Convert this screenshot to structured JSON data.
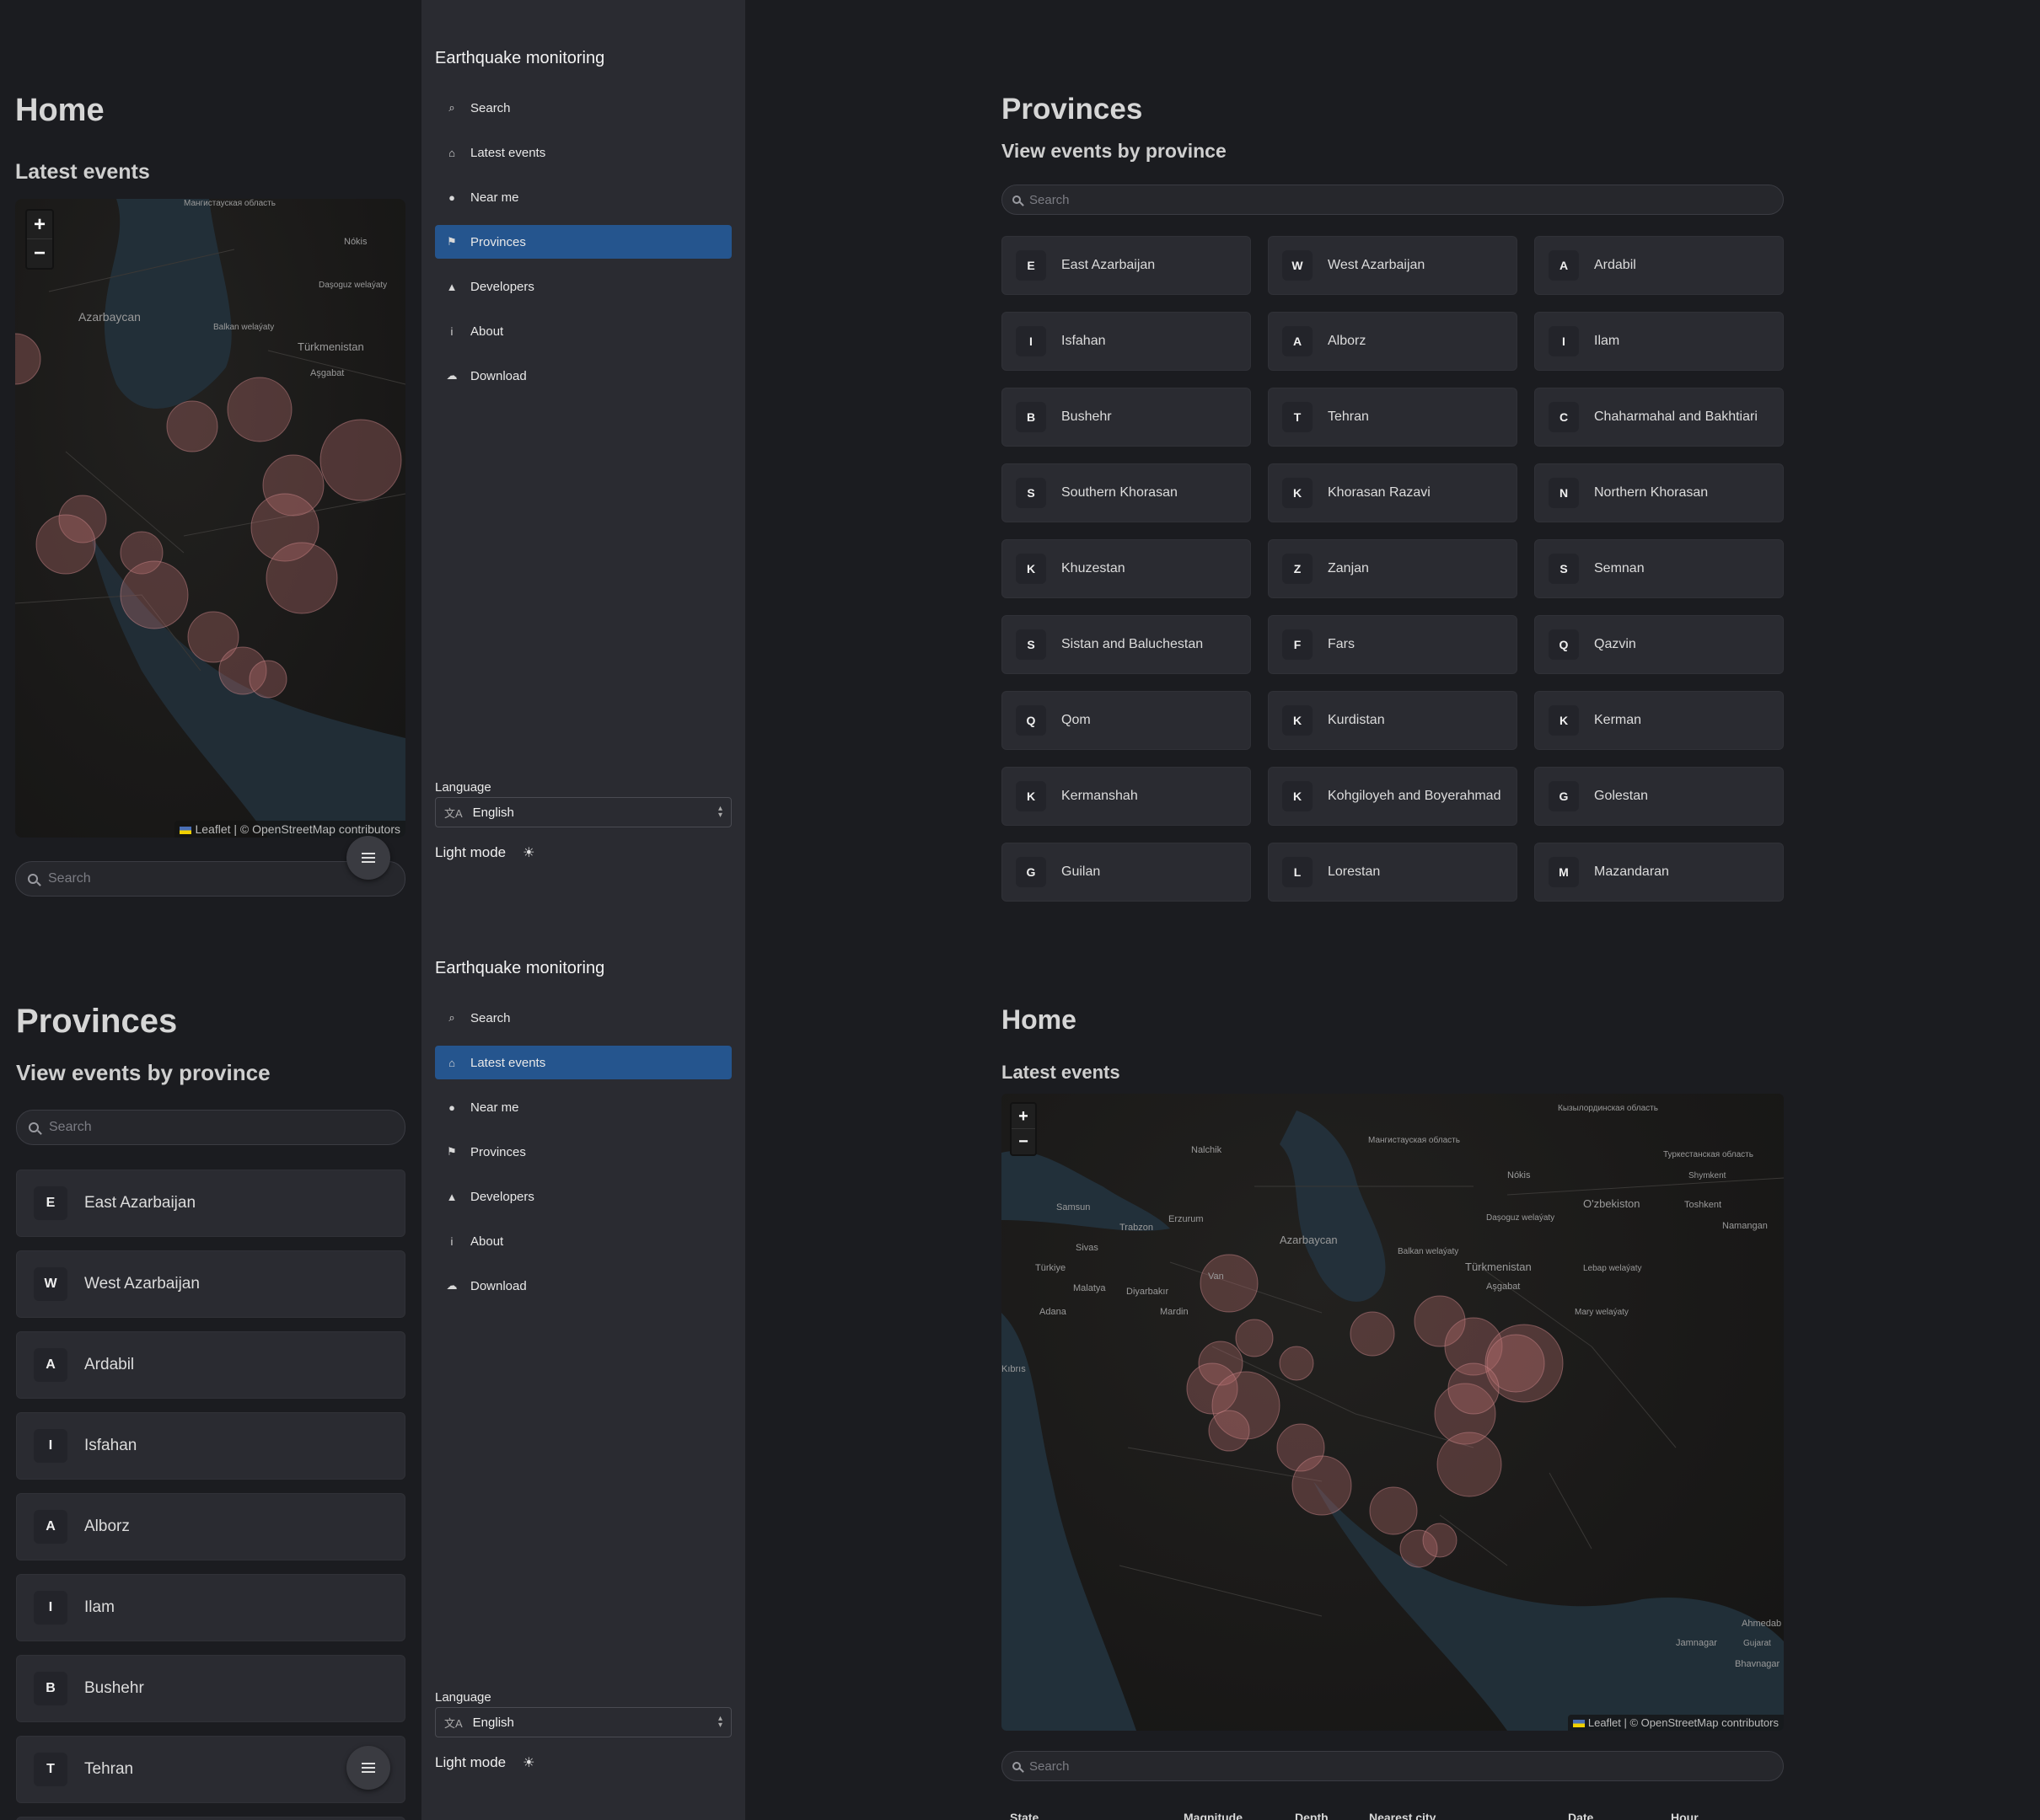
{
  "nav": {
    "title": "Earthquake monitoring",
    "items": [
      {
        "label": "Search",
        "icon": "search-icon"
      },
      {
        "label": "Latest events",
        "icon": "home-icon"
      },
      {
        "label": "Near me",
        "icon": "location-pin-icon"
      },
      {
        "label": "Provinces",
        "icon": "flag-icon"
      },
      {
        "label": "Developers",
        "icon": "shapes-icon"
      },
      {
        "label": "About",
        "icon": "info-icon"
      },
      {
        "label": "Download",
        "icon": "cloud-download-icon"
      }
    ],
    "language_label": "Language",
    "language_value": "English",
    "light_mode_label": "Light mode"
  },
  "home": {
    "title": "Home",
    "subtitle": "Latest events",
    "search_placeholder": "Search",
    "zoom_in": "+",
    "zoom_out": "−",
    "attribution": "Leaflet | © OpenStreetMap contributors",
    "table_headers": [
      "State",
      "Magnitude",
      "Depth",
      "Nearest city",
      "Date",
      "Hour"
    ]
  },
  "provinces": {
    "title": "Provinces",
    "subtitle": "View events by province",
    "search_placeholder": "Search",
    "list": [
      {
        "letter": "E",
        "name": "East Azarbaijan"
      },
      {
        "letter": "W",
        "name": "West Azarbaijan"
      },
      {
        "letter": "A",
        "name": "Ardabil"
      },
      {
        "letter": "I",
        "name": "Isfahan"
      },
      {
        "letter": "A",
        "name": "Alborz"
      },
      {
        "letter": "I",
        "name": "Ilam"
      },
      {
        "letter": "B",
        "name": "Bushehr"
      },
      {
        "letter": "T",
        "name": "Tehran"
      },
      {
        "letter": "C",
        "name": "Chaharmahal and Bakhtiari"
      },
      {
        "letter": "S",
        "name": "Southern Khorasan"
      },
      {
        "letter": "K",
        "name": "Khorasan Razavi"
      },
      {
        "letter": "N",
        "name": "Northern Khorasan"
      },
      {
        "letter": "K",
        "name": "Khuzestan"
      },
      {
        "letter": "Z",
        "name": "Zanjan"
      },
      {
        "letter": "S",
        "name": "Semnan"
      },
      {
        "letter": "S",
        "name": "Sistan and Baluchestan"
      },
      {
        "letter": "F",
        "name": "Fars"
      },
      {
        "letter": "Q",
        "name": "Qazvin"
      },
      {
        "letter": "Q",
        "name": "Qom"
      },
      {
        "letter": "K",
        "name": "Kurdistan"
      },
      {
        "letter": "K",
        "name": "Kerman"
      },
      {
        "letter": "K",
        "name": "Kermanshah"
      },
      {
        "letter": "K",
        "name": "Kohgiloyeh and Boyerahmad"
      },
      {
        "letter": "G",
        "name": "Golestan"
      },
      {
        "letter": "G",
        "name": "Guilan"
      },
      {
        "letter": "L",
        "name": "Lorestan"
      },
      {
        "letter": "M",
        "name": "Mazandaran"
      }
    ]
  },
  "map_labels_small": [
    "Nókis",
    "Azarbaycan",
    "Türkmenistan",
    "Aşgabat",
    "Balkan welaýaty",
    "Daşoguz welaýaty",
    "Мангистауская область"
  ],
  "map_labels_large": [
    "Nókis",
    "O'zbekiston",
    "Toshkent",
    "Namangan",
    "Azarbaycan",
    "Türkmenistan",
    "Aşgabat",
    "Türkiye",
    "Erzurum",
    "Trabzon",
    "Samsun",
    "Sivas",
    "Malatya",
    "Diyarbakır",
    "Mardin",
    "Adana",
    "Kıbrıs",
    "Van",
    "Balkan welaýaty",
    "Lebap welaýaty",
    "Mary welaýaty",
    "Jamnagar",
    "Bhavnagar",
    "Ahmedab",
    "Gujarat",
    "Nalchik",
    "Daşoguz welaýaty",
    "Мангистауская область",
    "Кызылординская область",
    "Туркестанская область",
    "Shymkent"
  ],
  "colors": {
    "accent": "#25558e",
    "bg": "#1b1c20",
    "sidebar": "#2a2b31",
    "quake": "#b46e6e"
  }
}
